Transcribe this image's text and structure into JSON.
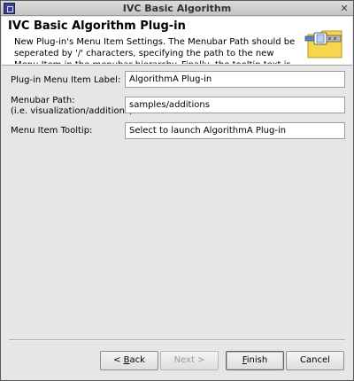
{
  "window": {
    "title": "IVC Basic Algorithm",
    "close_glyph": "✕"
  },
  "banner": {
    "title": "IVC Basic Algorithm Plug-in",
    "description": "New Plug-in's Menu Item Settings.  The Menubar Path should be seperated by '/' characters, specifying the path to the new Menu Item in the menubar hierarchy. Finally, the tooltip text is",
    "icon": "plugin-folder-icon"
  },
  "form": {
    "menu_item_label": {
      "label": "Plug-in Menu Item Label:",
      "value": "AlgorithmA Plug-in"
    },
    "menubar_path": {
      "label_line1": "Menubar Path:",
      "label_line2": "(i.e. visualization/additions)",
      "value": "samples/additions"
    },
    "tooltip": {
      "label": "Menu Item Tooltip:",
      "value": "Select to launch AlgorithmA Plug-in"
    }
  },
  "buttons": {
    "back": {
      "mnemonic": "B",
      "rest": "ack",
      "prefix": "< "
    },
    "next": {
      "label": "Next >"
    },
    "finish": {
      "mnemonic": "F",
      "rest": "inish"
    },
    "cancel": {
      "label": "Cancel"
    }
  }
}
